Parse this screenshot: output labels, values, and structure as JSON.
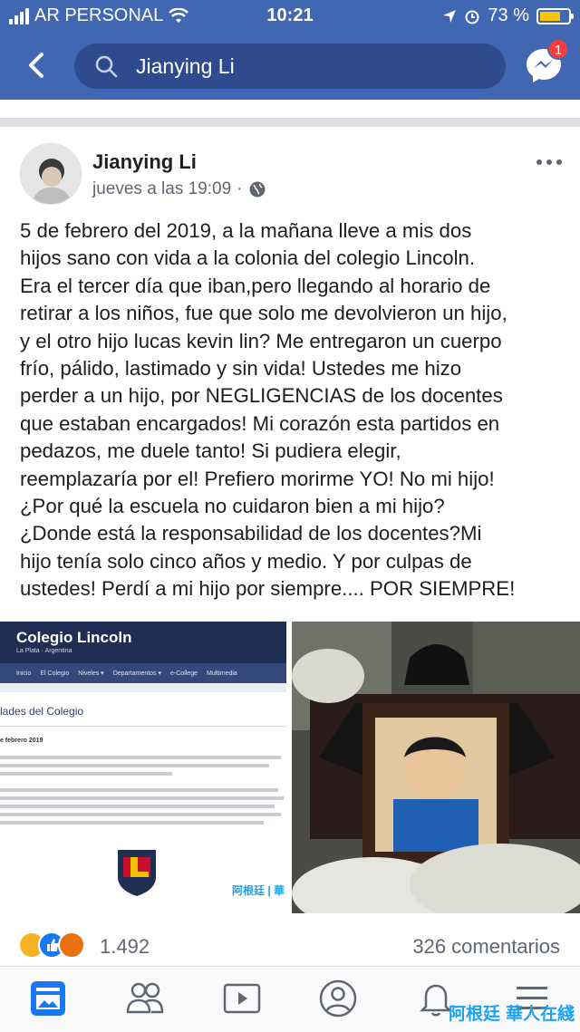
{
  "status_bar": {
    "carrier": "AR PERSONAL",
    "time": "10:21",
    "battery_percent": "73 %",
    "battery_level": 0.73
  },
  "search": {
    "query": "Jianying Li",
    "messenger_badge": "1"
  },
  "post": {
    "author": "Jianying Li",
    "timestamp": "jueves a las 19:09",
    "separator": "·",
    "text": "5 de febrero del 2019, a la mañana lleve a mis dos\nhijos sano con vida a la colonia del colegio Lincoln.\nEra el tercer día que iban,pero llegando al horario de\nretirar a los niños, fue que solo me devolvieron un hijo,\ny el otro hijo lucas kevin lin? Me entregaron un cuerpo\nfrío, pálido, lastimado y sin vida! Ustedes me hizo\nperder a un hijo, por NEGLIGENCIAS de los docentes\nque estaban encargados! Mi corazón esta partidos en\npedazos, me duele tanto! Si pudiera elegir,\nreemplazaría por el! Prefiero morirme YO! No mi hijo!\n¿Por qué la escuela no cuidaron bien a mi hijo?\n¿Donde está la responsabilidad de los docentes?Mi\nhijo tenía solo cinco años y medio. Y por culpas de\nustedes! Perdí a mi hijo por siempre.... POR SIEMPRE!"
  },
  "image_left": {
    "site_title": "Colegio Lincoln",
    "site_subtitle": "La Plata · Argentina",
    "nav": [
      "Inicio",
      "El Colegio",
      "Niveles ▾",
      "Departamentos ▾",
      "e-College",
      "Multimedia"
    ],
    "section": "lades del Colegio",
    "date_line": "e febrero 2019",
    "watermark": "阿根廷 | 華"
  },
  "reactions": {
    "count": "1.492",
    "comments": "326 comentarios"
  },
  "watermark": {
    "left": "阿根廷",
    "right": "華人在綫"
  },
  "colors": {
    "brand": "#4267b2",
    "badge": "#fa3e3e",
    "battery": "#f7c600"
  },
  "icons": [
    "back-icon",
    "search-icon",
    "messenger-icon",
    "globe-icon",
    "more-icon",
    "news-feed-icon",
    "groups-icon",
    "watch-icon",
    "profile-icon",
    "notifications-icon",
    "menu-icon"
  ]
}
